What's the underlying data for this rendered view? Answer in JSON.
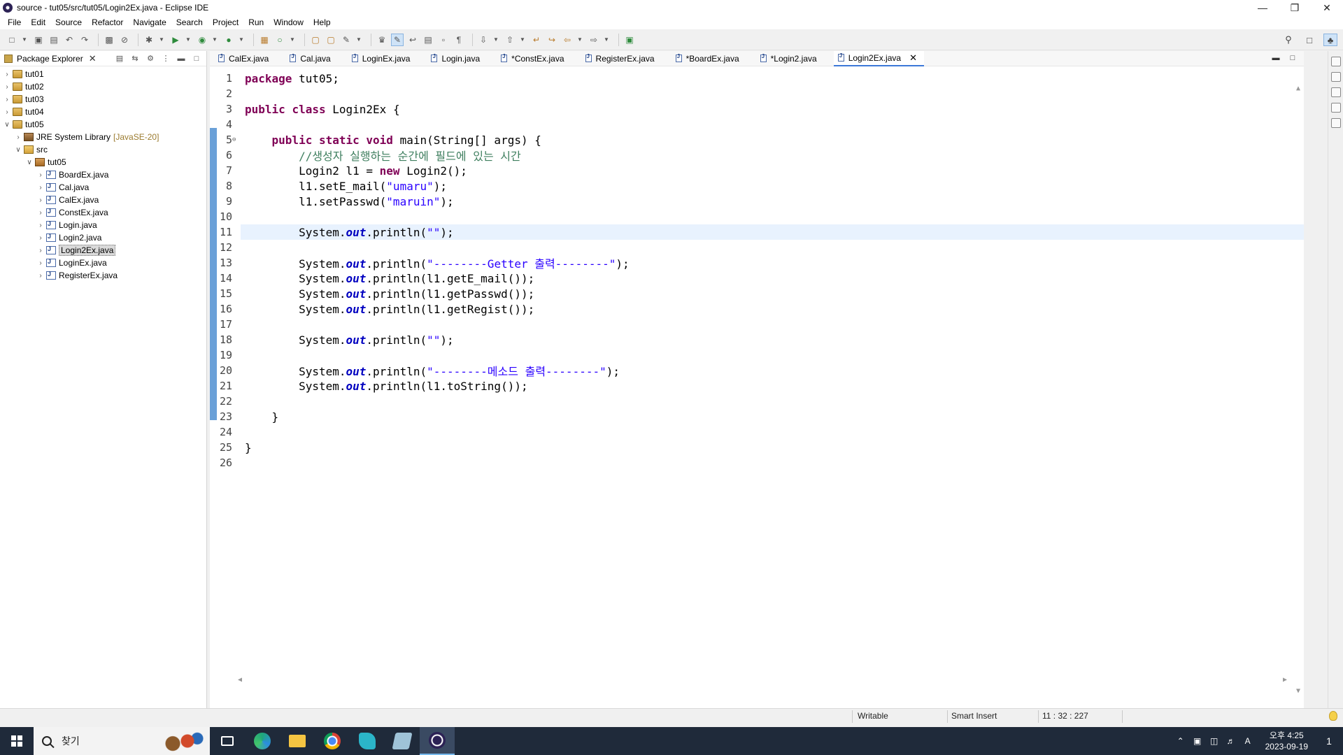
{
  "window": {
    "title": "source - tut05/src/tut05/Login2Ex.java - Eclipse IDE"
  },
  "menu": [
    "File",
    "Edit",
    "Source",
    "Refactor",
    "Navigate",
    "Search",
    "Project",
    "Run",
    "Window",
    "Help"
  ],
  "package_explorer": {
    "tab_label": "Package Explorer",
    "tree": [
      {
        "label": "tut01",
        "level": 0,
        "type": "project",
        "expanded": false
      },
      {
        "label": "tut02",
        "level": 0,
        "type": "project",
        "expanded": false
      },
      {
        "label": "tut03",
        "level": 0,
        "type": "project",
        "expanded": false
      },
      {
        "label": "tut04",
        "level": 0,
        "type": "project",
        "expanded": false
      },
      {
        "label": "tut05",
        "level": 0,
        "type": "project",
        "expanded": true
      },
      {
        "label": "JRE System Library",
        "suffix": "[JavaSE-20]",
        "level": 1,
        "type": "jre",
        "expanded": false
      },
      {
        "label": "src",
        "level": 1,
        "type": "src",
        "expanded": true
      },
      {
        "label": "tut05",
        "level": 2,
        "type": "pkg",
        "expanded": true
      },
      {
        "label": "BoardEx.java",
        "level": 3,
        "type": "java"
      },
      {
        "label": "Cal.java",
        "level": 3,
        "type": "java"
      },
      {
        "label": "CalEx.java",
        "level": 3,
        "type": "java"
      },
      {
        "label": "ConstEx.java",
        "level": 3,
        "type": "java"
      },
      {
        "label": "Login.java",
        "level": 3,
        "type": "java"
      },
      {
        "label": "Login2.java",
        "level": 3,
        "type": "java"
      },
      {
        "label": "Login2Ex.java",
        "level": 3,
        "type": "java",
        "selected": true
      },
      {
        "label": "LoginEx.java",
        "level": 3,
        "type": "java"
      },
      {
        "label": "RegisterEx.java",
        "level": 3,
        "type": "java"
      }
    ]
  },
  "editor_tabs": [
    {
      "label": "CalEx.java"
    },
    {
      "label": "Cal.java"
    },
    {
      "label": "LoginEx.java"
    },
    {
      "label": "Login.java"
    },
    {
      "label": "*ConstEx.java"
    },
    {
      "label": "RegisterEx.java"
    },
    {
      "label": "*BoardEx.java"
    },
    {
      "label": "*Login2.java"
    },
    {
      "label": "Login2Ex.java",
      "active": true
    }
  ],
  "code": [
    {
      "n": "1",
      "tokens": [
        [
          "kw",
          "package"
        ],
        [
          "t",
          " tut05;"
        ]
      ]
    },
    {
      "n": "2",
      "tokens": []
    },
    {
      "n": "3",
      "tokens": [
        [
          "kw",
          "public"
        ],
        [
          "t",
          " "
        ],
        [
          "kw",
          "class"
        ],
        [
          "t",
          " Login2Ex {"
        ]
      ]
    },
    {
      "n": "4",
      "tokens": []
    },
    {
      "n": "5",
      "fold": true,
      "tokens": [
        [
          "t",
          "    "
        ],
        [
          "kw",
          "public"
        ],
        [
          "t",
          " "
        ],
        [
          "kw",
          "static"
        ],
        [
          "t",
          " "
        ],
        [
          "kw",
          "void"
        ],
        [
          "t",
          " main(String[] args) {"
        ]
      ]
    },
    {
      "n": "6",
      "tokens": [
        [
          "t",
          "        "
        ],
        [
          "cmt",
          "//생성자 실행하는 순간에 필드에 있는 시간"
        ]
      ]
    },
    {
      "n": "7",
      "tokens": [
        [
          "t",
          "        Login2 l1 = "
        ],
        [
          "kw",
          "new"
        ],
        [
          "t",
          " Login2();"
        ]
      ]
    },
    {
      "n": "8",
      "tokens": [
        [
          "t",
          "        l1.setE_mail("
        ],
        [
          "str",
          "\"umaru\""
        ],
        [
          "t",
          ");"
        ]
      ]
    },
    {
      "n": "9",
      "tokens": [
        [
          "t",
          "        l1.setPasswd("
        ],
        [
          "str",
          "\"maruin\""
        ],
        [
          "t",
          ");"
        ]
      ]
    },
    {
      "n": "10",
      "tokens": []
    },
    {
      "n": "11",
      "current": true,
      "tokens": [
        [
          "t",
          "        System."
        ],
        [
          "fld",
          "out"
        ],
        [
          "t",
          ".println("
        ],
        [
          "str",
          "\"\""
        ],
        [
          "t",
          ");"
        ]
      ]
    },
    {
      "n": "12",
      "tokens": []
    },
    {
      "n": "13",
      "tokens": [
        [
          "t",
          "        System."
        ],
        [
          "fld",
          "out"
        ],
        [
          "t",
          ".println("
        ],
        [
          "str",
          "\"--------Getter 출력--------\""
        ],
        [
          "t",
          ");"
        ]
      ]
    },
    {
      "n": "14",
      "tokens": [
        [
          "t",
          "        System."
        ],
        [
          "fld",
          "out"
        ],
        [
          "t",
          ".println(l1.getE_mail());"
        ]
      ]
    },
    {
      "n": "15",
      "tokens": [
        [
          "t",
          "        System."
        ],
        [
          "fld",
          "out"
        ],
        [
          "t",
          ".println(l1.getPasswd());"
        ]
      ]
    },
    {
      "n": "16",
      "tokens": [
        [
          "t",
          "        System."
        ],
        [
          "fld",
          "out"
        ],
        [
          "t",
          ".println(l1.getRegist());"
        ]
      ]
    },
    {
      "n": "17",
      "tokens": []
    },
    {
      "n": "18",
      "tokens": [
        [
          "t",
          "        System."
        ],
        [
          "fld",
          "out"
        ],
        [
          "t",
          ".println("
        ],
        [
          "str",
          "\"\""
        ],
        [
          "t",
          ");"
        ]
      ]
    },
    {
      "n": "19",
      "tokens": []
    },
    {
      "n": "20",
      "tokens": [
        [
          "t",
          "        System."
        ],
        [
          "fld",
          "out"
        ],
        [
          "t",
          ".println("
        ],
        [
          "str",
          "\"--------메소드 출력--------\""
        ],
        [
          "t",
          ");"
        ]
      ]
    },
    {
      "n": "21",
      "tokens": [
        [
          "t",
          "        System."
        ],
        [
          "fld",
          "out"
        ],
        [
          "t",
          ".println(l1.toString());"
        ]
      ]
    },
    {
      "n": "22",
      "tokens": []
    },
    {
      "n": "23",
      "tokens": [
        [
          "t",
          "    }"
        ]
      ]
    },
    {
      "n": "24",
      "tokens": []
    },
    {
      "n": "25",
      "tokens": [
        [
          "t",
          "}"
        ]
      ]
    },
    {
      "n": "26",
      "tokens": []
    }
  ],
  "status": {
    "writable": "Writable",
    "insert_mode": "Smart Insert",
    "position": "11 : 32 : 227"
  },
  "taskbar": {
    "search_placeholder": "찾기",
    "time": "오후 4:25",
    "date": "2023-09-19",
    "notification_count": "1",
    "ime": "A"
  },
  "colors": {
    "keyword": "#7f0055",
    "string": "#2a00ff",
    "comment": "#3f7f5f",
    "field": "#0000c0",
    "current_line": "#e8f2fe",
    "change_bar": "#6aa0d8",
    "taskbar": "#1f2a3a"
  }
}
